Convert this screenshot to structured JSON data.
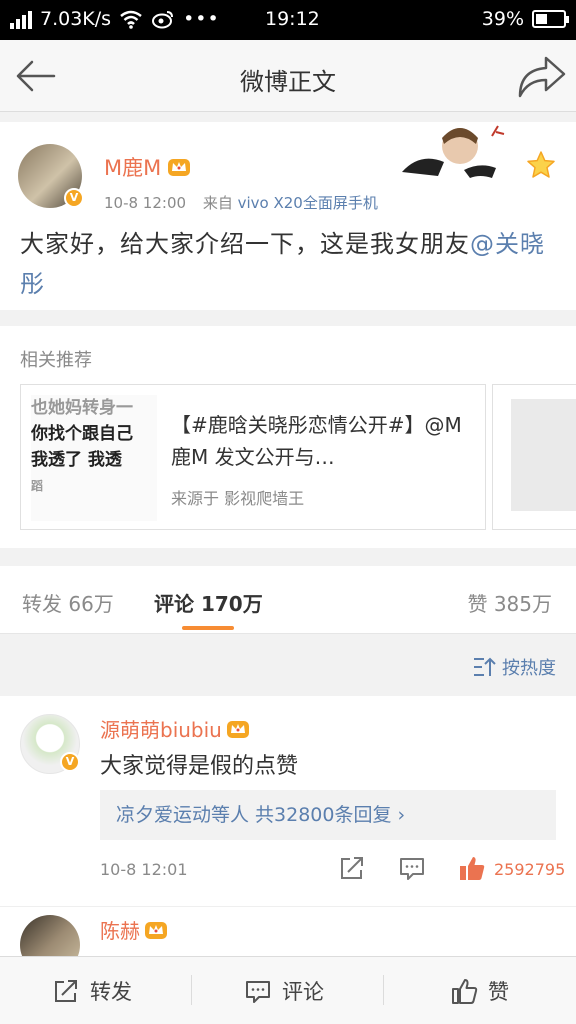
{
  "status_bar": {
    "speed": "7.03K/s",
    "time": "19:12",
    "battery": "39%"
  },
  "nav": {
    "title": "微博正文"
  },
  "post": {
    "author": "M鹿M",
    "time": "10-8 12:00",
    "source_prefix": "来自",
    "source": "vivo X20全面屏手机",
    "text": "大家好，给大家介绍一下，这是我女朋友",
    "mention": "@关晓彤"
  },
  "related": {
    "title": "相关推荐",
    "thumb_lines": [
      "也她妈转身一",
      "你找个跟自己",
      "我透了 我透",
      "蹈"
    ],
    "text": "【#鹿晗关晓彤恋情公开#】@M鹿M 发文公开与…",
    "source": "来源于 影视爬墙王"
  },
  "tabs": {
    "repost": "转发 66万",
    "comment": "评论 170万",
    "like": "赞 385万"
  },
  "sort": {
    "label": "按热度"
  },
  "comment1": {
    "author": "源萌萌biubiu",
    "text": "大家觉得是假的点赞",
    "reply_summary": "凉夕爱运动等人 共32800条回复 ›",
    "time": "10-8 12:01",
    "likes": "2592795"
  },
  "comment2": {
    "author": "陈赫"
  },
  "bottom_bar": {
    "repost": "转发",
    "comment": "评论",
    "like": "赞"
  },
  "colors": {
    "accent_orange": "#eb7350",
    "link_blue": "#5b7fae",
    "tab_underline": "#f78c33",
    "vip_gold": "#f5a623"
  }
}
